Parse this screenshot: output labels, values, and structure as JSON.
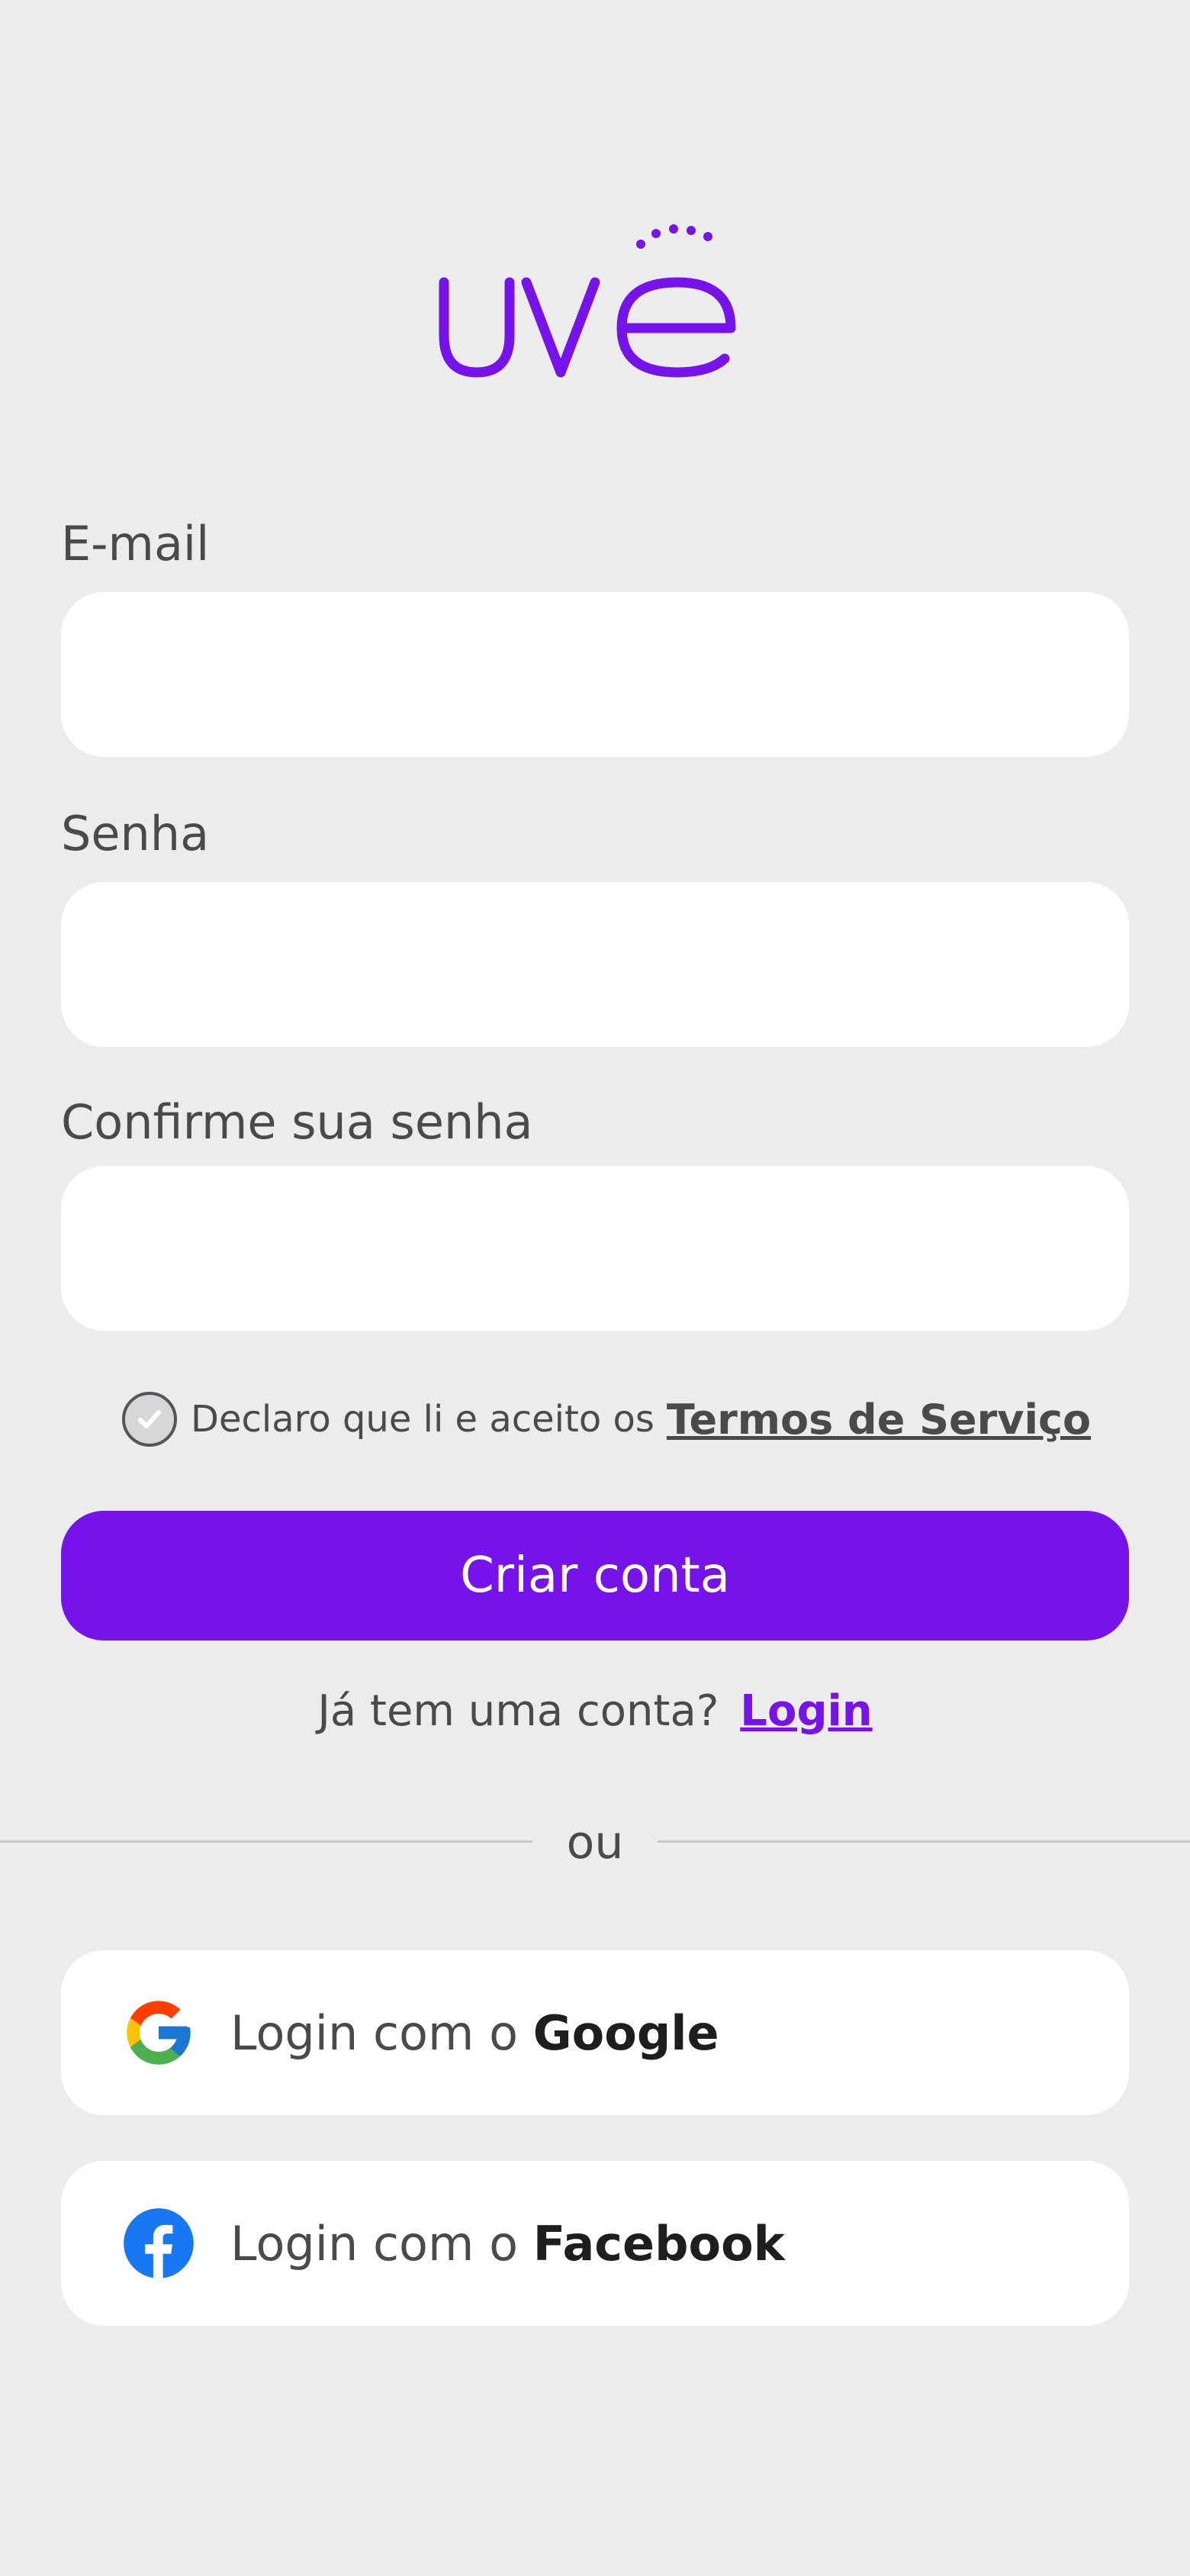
{
  "brand": {
    "logo_text": "uvê",
    "accent_color": "#7612ea"
  },
  "form": {
    "email_label": "E-mail",
    "email_value": "",
    "password_label": "Senha",
    "password_value": "",
    "confirm_label": "Confirme sua senha",
    "confirm_value": ""
  },
  "terms": {
    "checked": false,
    "text": "Declaro que li e aceito os",
    "link": "Termos de Serviço"
  },
  "actions": {
    "create_account": "Criar conta",
    "have_account_text": "Já tem uma conta?",
    "login_link": "Login"
  },
  "divider": {
    "text": "ou"
  },
  "social": {
    "google": {
      "prefix": "Login com o",
      "brand": "Google",
      "icon": "google-icon"
    },
    "facebook": {
      "prefix": "Login com o",
      "brand": "Facebook",
      "icon": "facebook-icon"
    }
  }
}
